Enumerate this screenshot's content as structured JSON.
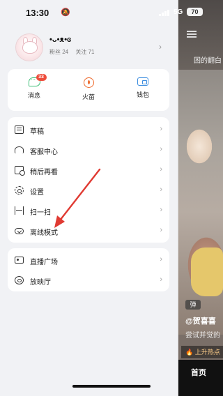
{
  "status_bar": {
    "time": "13:30",
    "network": "5G",
    "battery": "70"
  },
  "background_app": {
    "caption": "困的翻白",
    "music_badge": "弹",
    "author": "@贺喜喜",
    "description": "尝试并觉的",
    "hot_label": "上升热点",
    "home_tab": "首页"
  },
  "profile": {
    "name": "•ᴗ•ᴥ•ɞ",
    "fans_label": "粉丝 24",
    "following_label": "关注 71"
  },
  "quick_actions": [
    {
      "label": "消息",
      "icon": "message-icon",
      "badge": "33",
      "color": "#3dbf77"
    },
    {
      "label": "火苗",
      "icon": "fire-icon",
      "color": "#ee6a2c"
    },
    {
      "label": "钱包",
      "icon": "wallet-icon",
      "color": "#3f8fe0"
    }
  ],
  "menu_primary": [
    {
      "label": "草稿",
      "icon": "draft-icon"
    },
    {
      "label": "客服中心",
      "icon": "headset-icon"
    },
    {
      "label": "稍后再看",
      "icon": "watch-later-icon"
    },
    {
      "label": "设置",
      "icon": "gear-icon"
    },
    {
      "label": "扫一扫",
      "icon": "scan-icon"
    },
    {
      "label": "离线模式",
      "icon": "cloud-download-icon"
    }
  ],
  "menu_secondary": [
    {
      "label": "直播广场",
      "icon": "live-icon"
    },
    {
      "label": "放映厅",
      "icon": "theater-icon"
    }
  ],
  "colors": {
    "annotation_arrow": "#e03a32",
    "badge": "#ee4d3c"
  }
}
